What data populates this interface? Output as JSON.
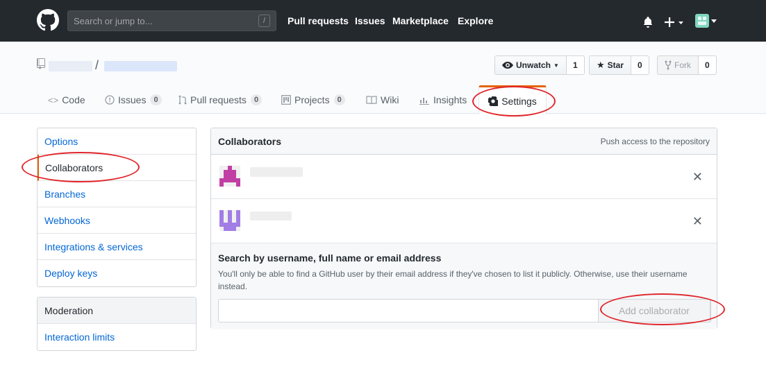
{
  "header": {
    "search_placeholder": "Search or jump to...",
    "search_shortcut": "/",
    "nav": [
      "Pull requests",
      "Issues",
      "Marketplace",
      "Explore"
    ]
  },
  "repo": {
    "separator": "/",
    "watch": {
      "label": "Unwatch",
      "count": "1"
    },
    "star": {
      "label": "Star",
      "count": "0"
    },
    "fork": {
      "label": "Fork",
      "count": "0"
    }
  },
  "tabs": [
    {
      "label": "Code",
      "icon": "code-icon"
    },
    {
      "label": "Issues",
      "count": "0",
      "icon": "issue-icon"
    },
    {
      "label": "Pull requests",
      "count": "0",
      "icon": "pull-request-icon"
    },
    {
      "label": "Projects",
      "count": "0",
      "icon": "project-icon"
    },
    {
      "label": "Wiki",
      "icon": "book-icon"
    },
    {
      "label": "Insights",
      "icon": "graph-icon"
    },
    {
      "label": "Settings",
      "icon": "gear-icon"
    }
  ],
  "sidebar": {
    "items": [
      "Options",
      "Collaborators",
      "Branches",
      "Webhooks",
      "Integrations & services",
      "Deploy keys"
    ],
    "moderation_heading": "Moderation",
    "moderation_items": [
      "Interaction limits"
    ]
  },
  "collaborators": {
    "title": "Collaborators",
    "subtitle": "Push access to the repository",
    "remove_symbol": "✕",
    "add_title": "Search by username, full name or email address",
    "add_help": "You'll only be able to find a GitHub user by their email address if they've chosen to list it publicly. Otherwise, use their username instead.",
    "add_button": "Add collaborator"
  },
  "colors": {
    "header_bg": "#24292e",
    "link": "#0366d6",
    "accent": "#e36209",
    "annotation": "#e0262b"
  }
}
